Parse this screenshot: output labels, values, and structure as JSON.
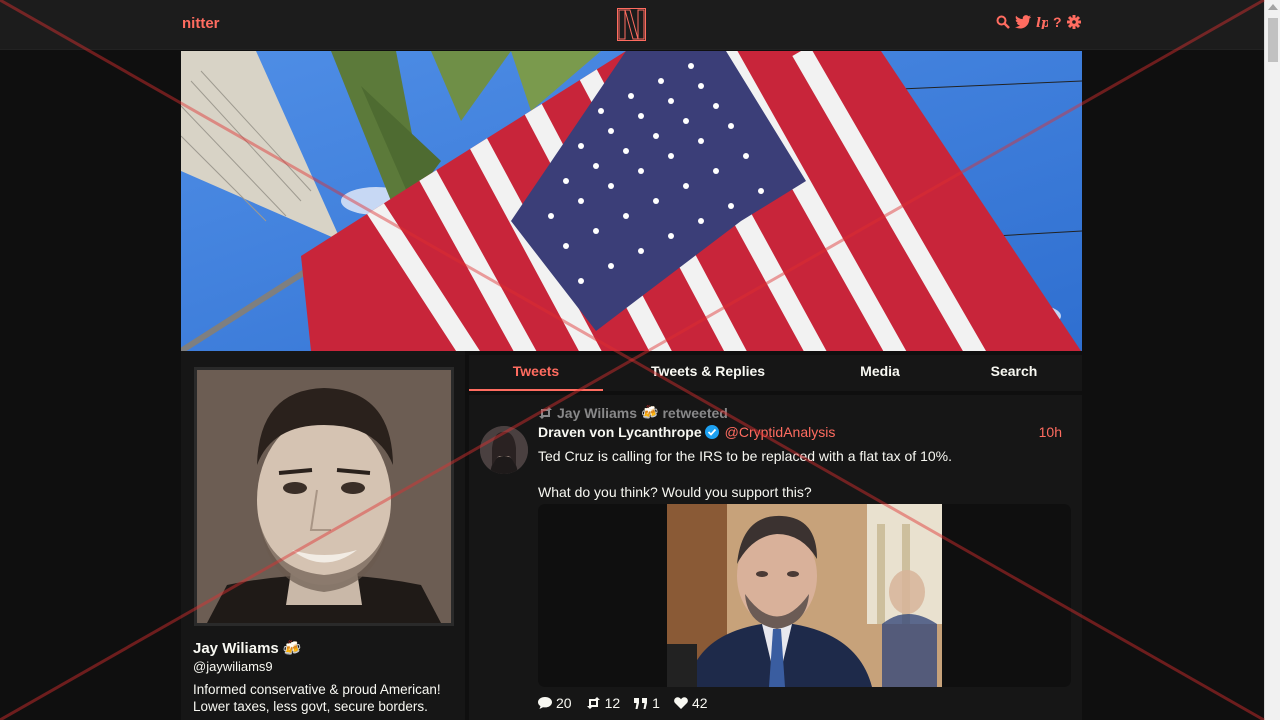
{
  "nav": {
    "site_name": "nitter",
    "logo_letter": "N",
    "icons": [
      "search-icon",
      "twitter-icon",
      "liberapay-icon",
      "help-icon",
      "settings-icon"
    ]
  },
  "colors": {
    "accent": "#ff6c60",
    "background": "#0f0f0f",
    "panel": "#161616",
    "nav": "#1c1c1c",
    "muted": "#888889",
    "verified": "#1da1f2"
  },
  "profile": {
    "name": "Jay Wiliams",
    "badge": "🍻",
    "handle": "@jaywiliams9",
    "bio_line1": "Informed conservative & proud American!",
    "bio_line2": "Lower taxes, less govt, secure borders."
  },
  "tabs": [
    {
      "label": "Tweets",
      "active": true
    },
    {
      "label": "Tweets & Replies",
      "active": false
    },
    {
      "label": "Media",
      "active": false
    },
    {
      "label": "Search",
      "active": false
    }
  ],
  "tweet": {
    "retweet_by": "Jay Wiliams",
    "retweet_badge": "🍻",
    "retweet_label": "retweeted",
    "fullname": "Draven von Lycanthrope",
    "username": "@CryptidAnalysis",
    "date": "10h",
    "text_line1": "Ted Cruz is calling for the IRS to be replaced with a flat tax of 10%.",
    "text_line2": "What do you think? Would you support this?",
    "stats": {
      "replies": "20",
      "retweets": "12",
      "quotes": "1",
      "likes": "42"
    }
  }
}
